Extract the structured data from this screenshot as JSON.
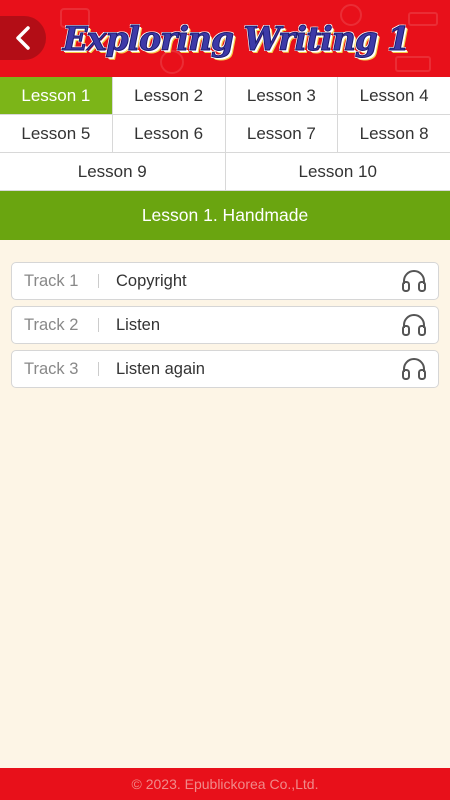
{
  "header": {
    "title": "Exploring Writing 1",
    "back_icon": "chevron-left-icon",
    "bg_color": "#e8101a"
  },
  "lessons": {
    "rows": [
      [
        {
          "label": "Lesson 1",
          "active": true
        },
        {
          "label": "Lesson 2",
          "active": false
        },
        {
          "label": "Lesson 3",
          "active": false
        },
        {
          "label": "Lesson 4",
          "active": false
        }
      ],
      [
        {
          "label": "Lesson 5",
          "active": false
        },
        {
          "label": "Lesson 6",
          "active": false
        },
        {
          "label": "Lesson 7",
          "active": false
        },
        {
          "label": "Lesson 8",
          "active": false
        }
      ],
      [
        {
          "label": "Lesson 9",
          "active": false
        },
        {
          "label": "Lesson 10",
          "active": false
        }
      ]
    ],
    "active_color": "#7cb518"
  },
  "lesson_title": "Lesson 1. Handmade",
  "tracks": [
    {
      "number": "Track 1",
      "name": "Copyright",
      "icon": "headphones-icon"
    },
    {
      "number": "Track 2",
      "name": "Listen",
      "icon": "headphones-icon"
    },
    {
      "number": "Track 3",
      "name": "Listen again",
      "icon": "headphones-icon"
    }
  ],
  "footer": {
    "copyright": "© 2023. Epublickorea Co.,Ltd."
  }
}
